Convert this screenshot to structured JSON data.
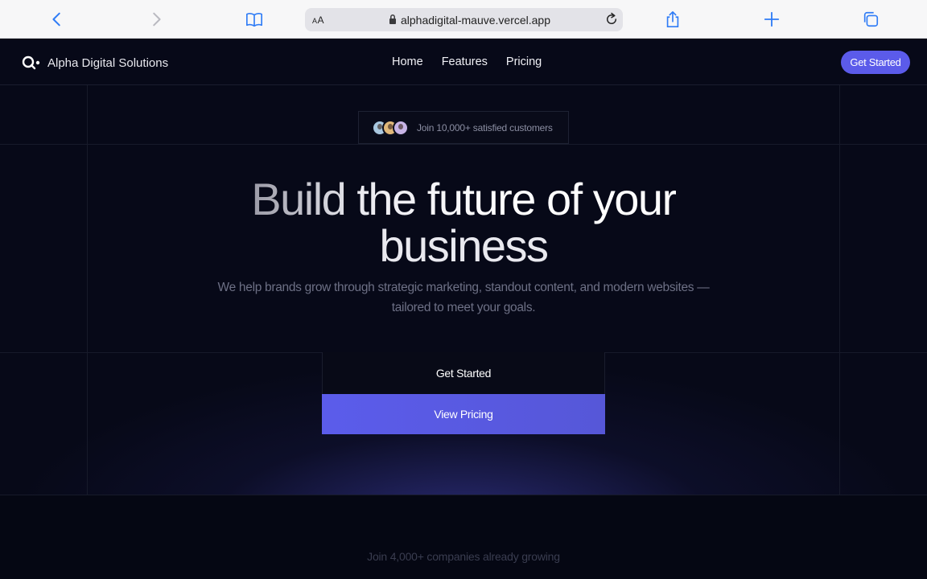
{
  "browser": {
    "reader_label_big": "A",
    "reader_label_small": "A",
    "url": "alphadigital-mauve.vercel.app",
    "icons": [
      "back-icon",
      "forward-icon",
      "bookmarks-icon",
      "lock-icon",
      "reload-icon",
      "share-icon",
      "new-tab-icon",
      "tabs-icon"
    ]
  },
  "nav": {
    "brand": "Alpha Digital Solutions",
    "links": [
      "Home",
      "Features",
      "Pricing"
    ],
    "cta": "Get Started"
  },
  "hero": {
    "badge": "Join 10,000+ satisfied customers",
    "title_line1": "Build the future of your",
    "title_line2": "business",
    "subtitle": "We help brands grow through strategic marketing, standout content, and modern websites — tailored to meet your goals.",
    "secondary_button": "Get Started",
    "primary_button": "View Pricing"
  },
  "logos": {
    "heading": "Join 4,000+ companies already growing"
  },
  "colors": {
    "accent": "#5b5bea",
    "background": "#070918"
  }
}
